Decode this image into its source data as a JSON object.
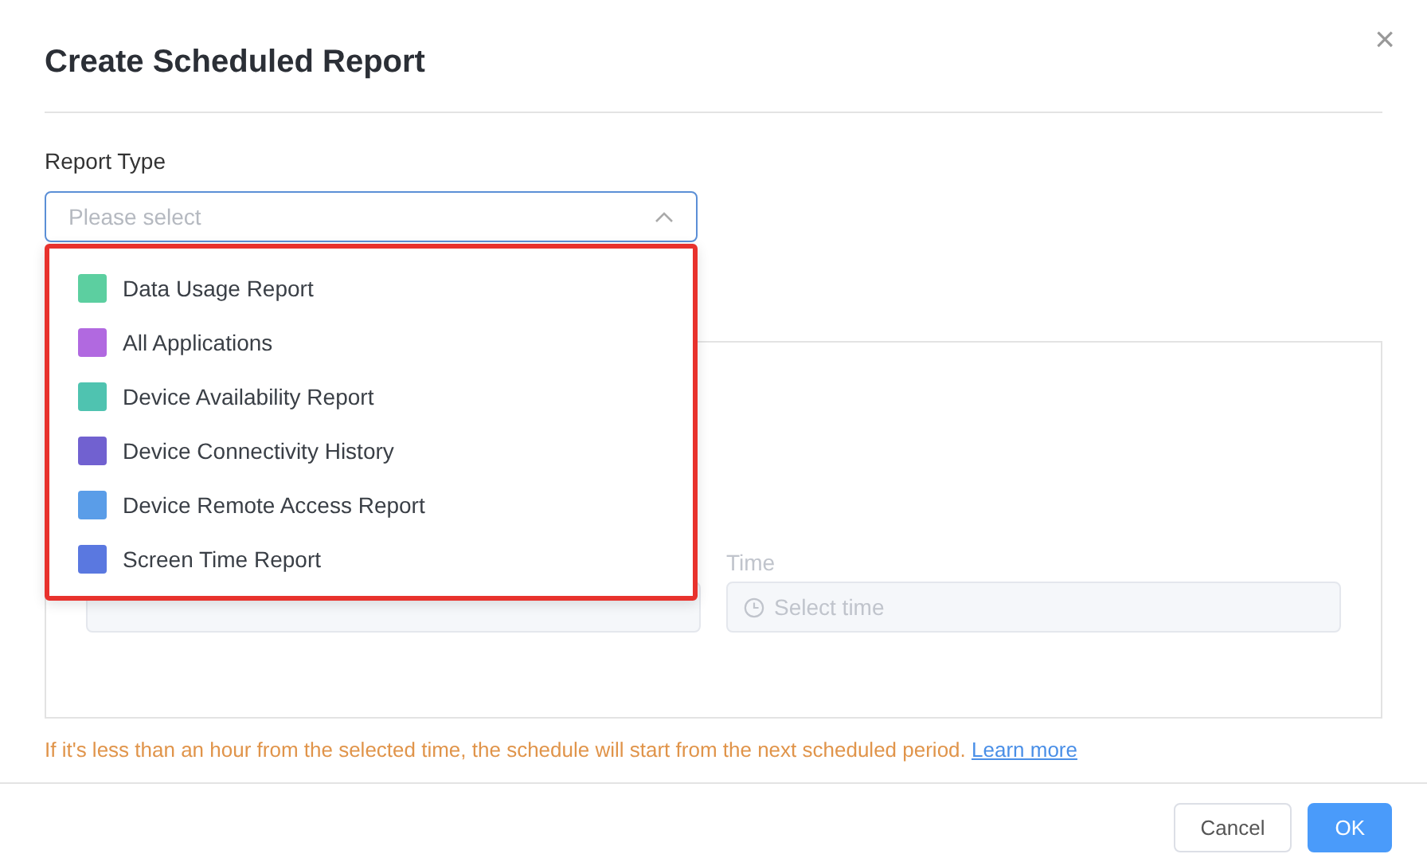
{
  "dialog": {
    "title": "Create Scheduled Report",
    "close": "×"
  },
  "report_type": {
    "label": "Report Type",
    "placeholder": "Please select",
    "expanded": true,
    "options": [
      {
        "label": "Data Usage Report",
        "color": "#5ccfa0"
      },
      {
        "label": "All Applications",
        "color": "#b169e0"
      },
      {
        "label": "Device Availability Report",
        "color": "#4fc3b0"
      },
      {
        "label": "Device Connectivity History",
        "color": "#7161d0"
      },
      {
        "label": "Device Remote Access Report",
        "color": "#5a9de8"
      },
      {
        "label": "Screen Time Report",
        "color": "#5a78e0"
      }
    ]
  },
  "schedule": {
    "time": {
      "label": "Time",
      "placeholder": "Select time"
    }
  },
  "note": {
    "text": "If it's less than an hour from the selected time, the schedule will start from the next scheduled period.",
    "link": "Learn more"
  },
  "buttons": [
    {
      "label": "Cancel",
      "kind": "secondary"
    },
    {
      "label": "OK",
      "kind": "primary"
    }
  ]
}
